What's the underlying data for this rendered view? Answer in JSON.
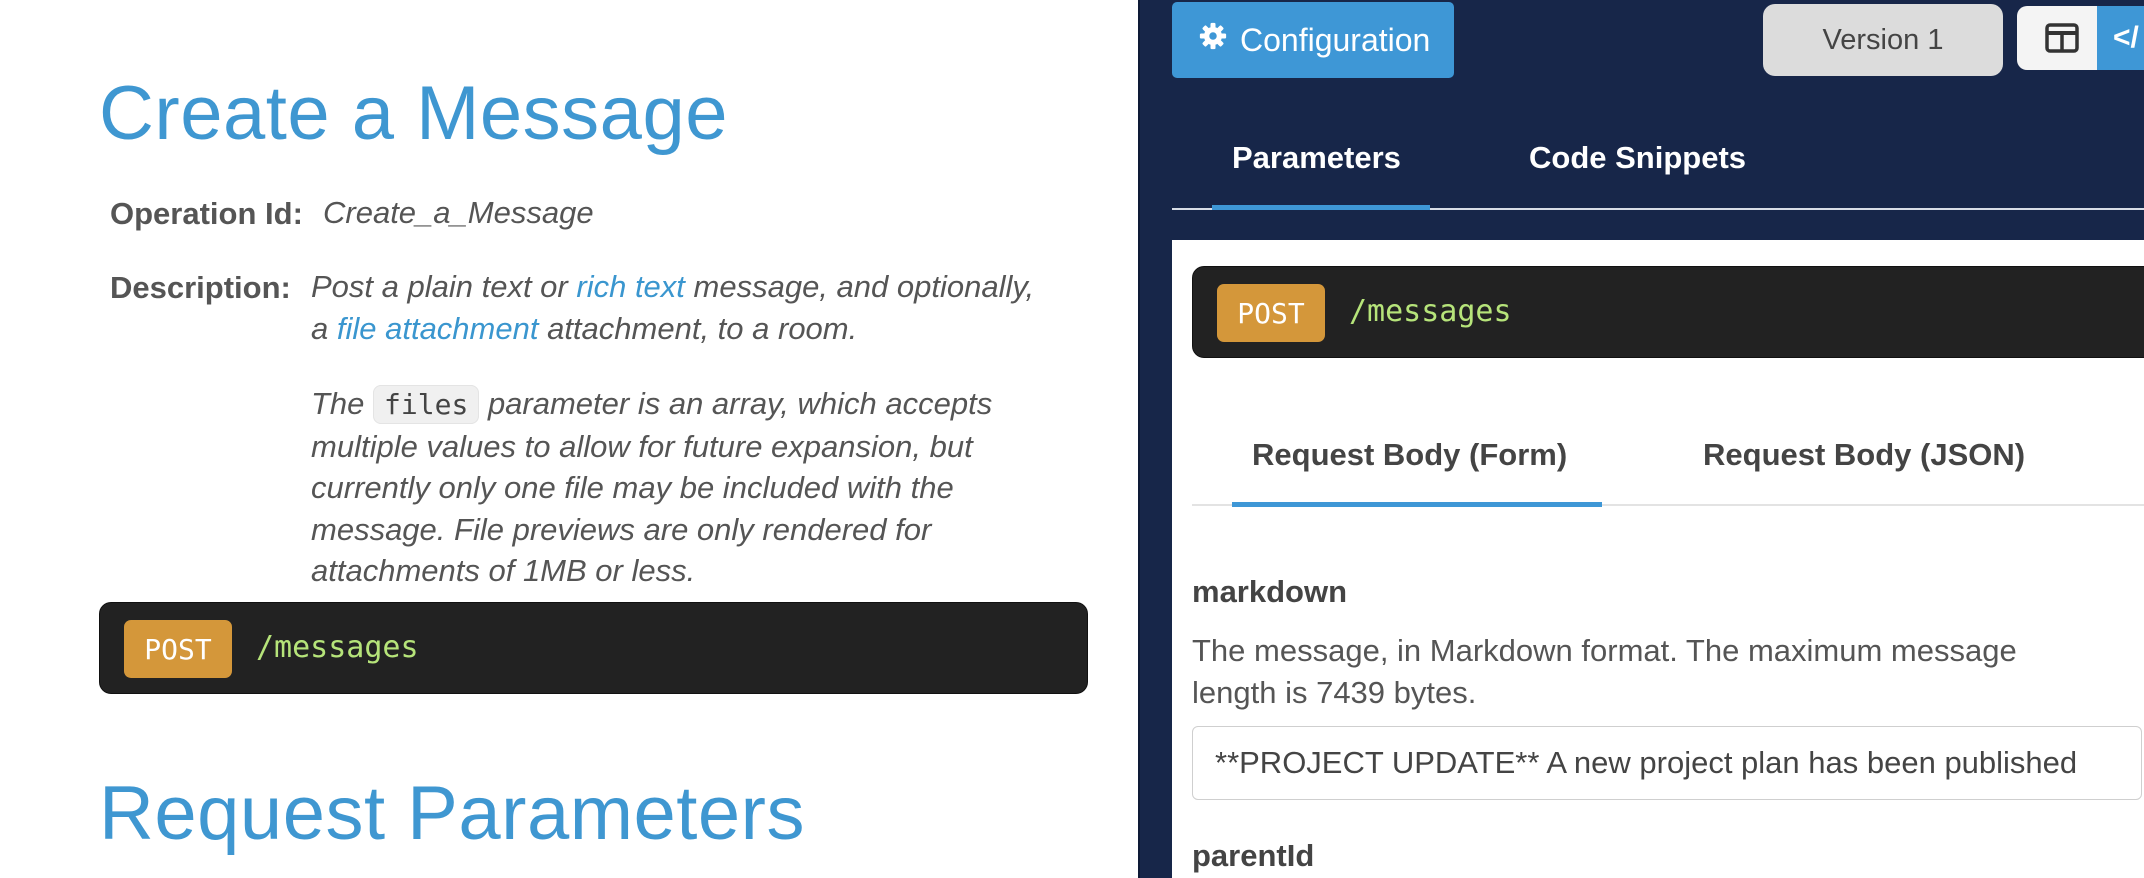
{
  "doc": {
    "title": "Create a Message",
    "operation_id_label": "Operation Id:",
    "operation_id_value": "Create_a_Message",
    "description_label": "Description:",
    "desc_line1_pre": "Post a plain text or ",
    "desc_link_rich_text": "rich text",
    "desc_line1_post": " message, and optionally,",
    "desc_line2_pre": "a ",
    "desc_link_file_attachment": "file attachment",
    "desc_line2_post": " attachment, to a room.",
    "files_pre": "The ",
    "files_code": "files",
    "files_post": " parameter is an array, which accepts",
    "files_line2": "multiple values to allow for future expansion, but",
    "files_line3": "currently only one file may be included with the",
    "files_line4": "message. File previews are only rendered for",
    "files_line5": "attachments of 1MB or less.",
    "endpoint_method": "POST",
    "endpoint_path": "/messages",
    "section_title": "Request Parameters"
  },
  "panel": {
    "config_label": "Configuration",
    "version_label": "Version 1",
    "code_toggle_label": "</",
    "tabs": [
      "Parameters",
      "Code Snippets"
    ],
    "active_tab": "Parameters",
    "endpoint_method": "POST",
    "endpoint_path": "/messages",
    "subtabs": [
      "Request Body (Form)",
      "Request Body (JSON)"
    ],
    "active_subtab": "Request Body (Form)",
    "params": [
      {
        "name": "markdown",
        "description": "The message, in Markdown format. The maximum message length is 7439 bytes.",
        "value": "**PROJECT UPDATE** A new project plan has been published"
      },
      {
        "name": "parentId"
      }
    ]
  },
  "colors": {
    "link_blue": "#3f97d1",
    "panel_navy": "#172649",
    "accent_blue": "#3e97d6",
    "method_orange": "#d4973a",
    "path_green": "#b6e47a",
    "endpoint_bg": "#222222"
  },
  "icons": {
    "config": "gear-icon",
    "split": "split-view-icon"
  }
}
